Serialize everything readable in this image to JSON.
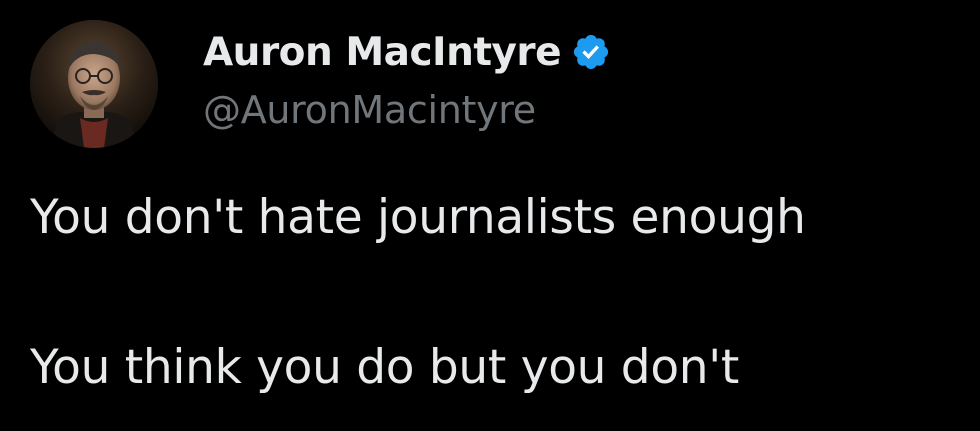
{
  "author": {
    "display_name": "Auron MacIntyre",
    "handle": "@AuronMacintyre",
    "verified": true,
    "avatar_icon": "profile-photo-avatar"
  },
  "tweet": {
    "lines": [
      "You don't hate journalists enough",
      "You think you do but you don't"
    ]
  },
  "colors": {
    "background": "#000000",
    "text": "#e7e9ea",
    "handle": "#71767b",
    "verified_badge": "#1d9bf0"
  }
}
